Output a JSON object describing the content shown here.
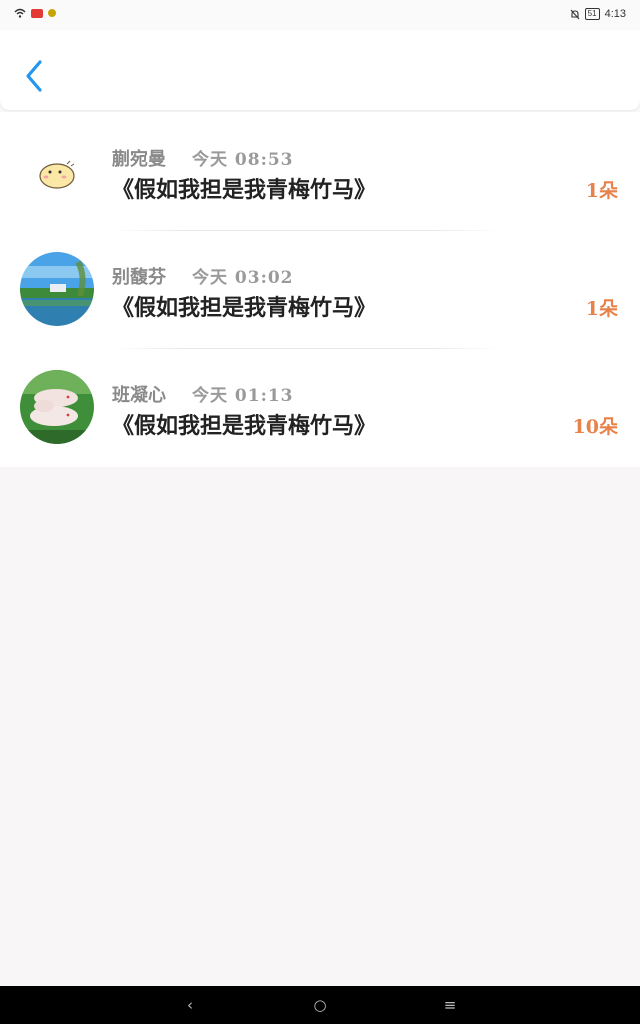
{
  "status_bar": {
    "time": "4:13",
    "battery": "51",
    "icons": [
      "wifi-icon",
      "hd-badge-icon",
      "notification-icon",
      "mute-icon",
      "battery-icon"
    ]
  },
  "header": {
    "back_icon": "chevron-left-icon",
    "accent_color": "#2196f3"
  },
  "list": {
    "items": [
      {
        "name": "蒯宛曼",
        "time": "今天 08:53",
        "book": "《假如我担是我青梅竹马》",
        "count": "1朵",
        "avatar": "hamster-avatar"
      },
      {
        "name": "别馥芬",
        "time": "今天 03:02",
        "book": "《假如我担是我青梅竹马》",
        "count": "1朵",
        "avatar": "lake-landscape-avatar"
      },
      {
        "name": "班凝心",
        "time": "今天 01:13",
        "book": "《假如我担是我青梅竹马》",
        "count": "10朵",
        "avatar": "rabbits-avatar"
      }
    ],
    "count_color": "#e8824b"
  },
  "nav_bar": {
    "back_glyph": "‹",
    "home_glyph": "○",
    "menu_glyph": "≡"
  }
}
